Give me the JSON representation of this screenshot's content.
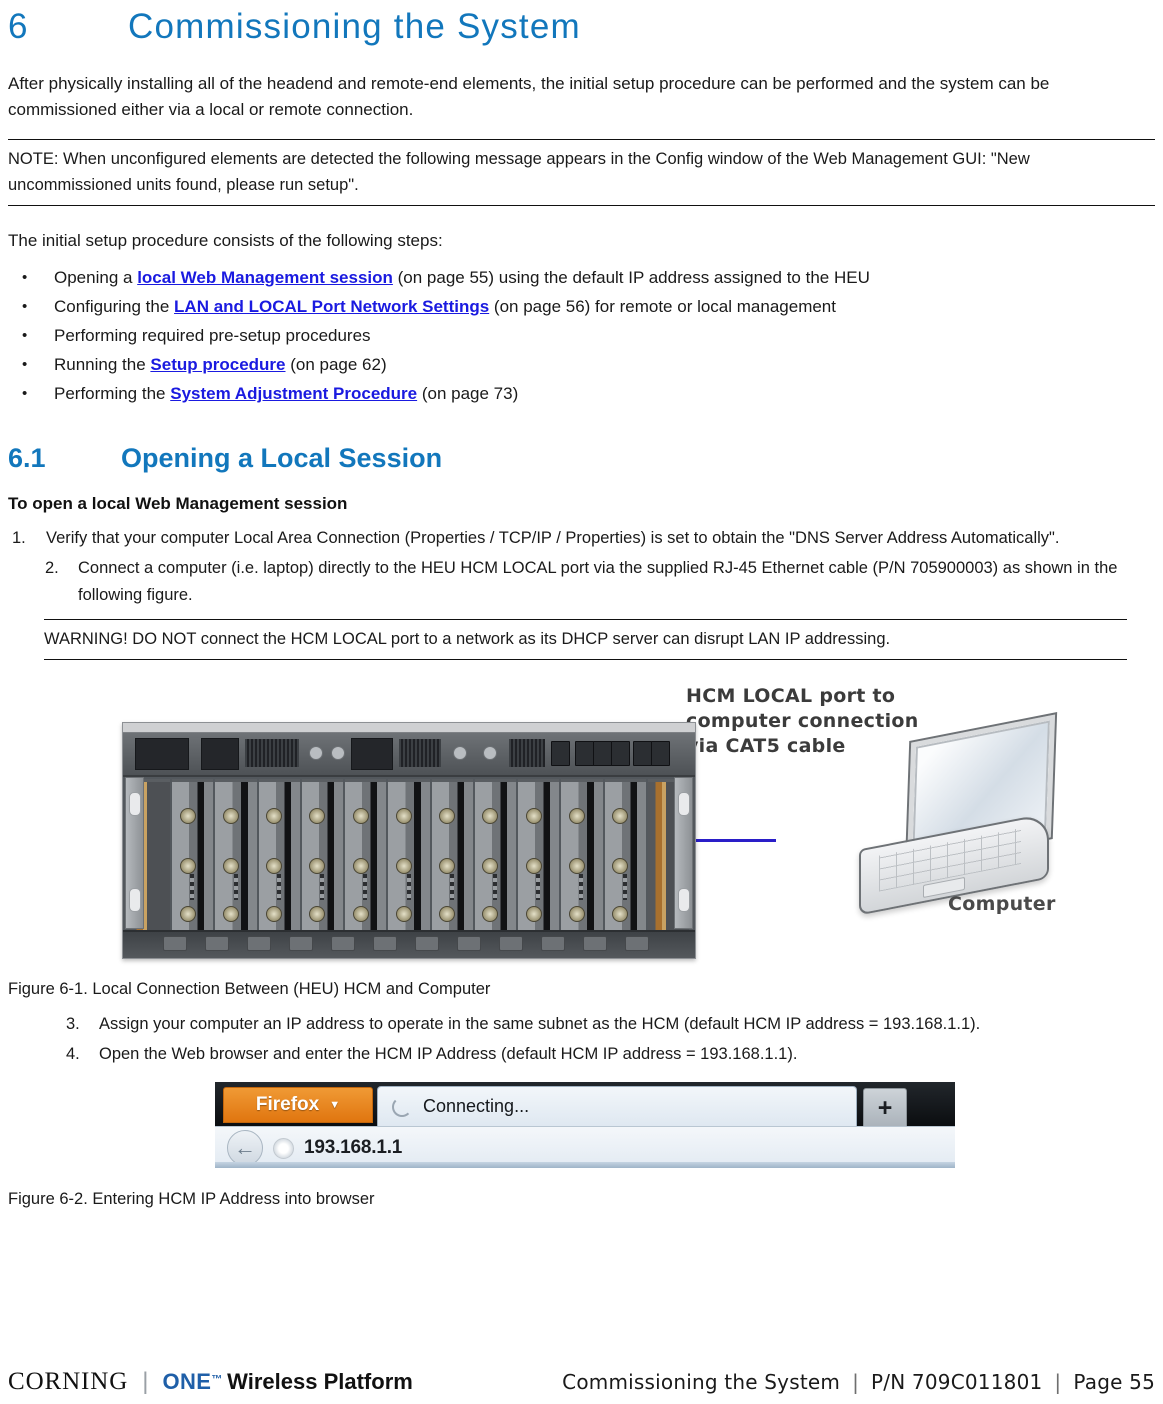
{
  "chapter": {
    "number": "6",
    "title": "Commissioning the System"
  },
  "intro_paragraph": "After physically installing all of the headend and remote-end elements, the initial setup procedure can be performed and the system can be commissioned either via a local or remote connection.",
  "note_block": "NOTE: When unconfigured elements are detected the following message appears in the Config window of the Web Management GUI: \"New uncommissioned units found, please run setup\".",
  "steps_intro": "The initial setup procedure consists of the following steps:",
  "bullets": [
    {
      "bullet": "•",
      "pre": "Opening a ",
      "link": "local Web Management session",
      "post": " (on page 55) using the default IP address assigned to the HEU"
    },
    {
      "bullet": "•",
      "pre": "Configuring the ",
      "link": "LAN and LOCAL Port Network Settings",
      "post": " (on page 56) for remote or local management"
    },
    {
      "bullet": "•",
      "pre": "Performing required pre-setup procedures",
      "link": "",
      "post": ""
    },
    {
      "bullet": "•",
      "pre": "Running the ",
      "link": "Setup procedure",
      "post": " (on page 62)"
    },
    {
      "bullet": "•",
      "pre": "Performing the ",
      "link": "System Adjustment Procedure",
      "post": " (on page 73)"
    }
  ],
  "section": {
    "number": "6.1",
    "title": "Opening a Local Session",
    "subheading": "To open a local Web Management session"
  },
  "steps": {
    "step1_num": "1.",
    "step1_text": "Verify that your computer Local Area Connection (Properties / TCP/IP / Properties) is set to obtain the \"DNS Server Address Automatically\".",
    "step2_num": "2.",
    "step2_text": "Connect a computer (i.e. laptop) directly to the HEU HCM LOCAL port via the supplied RJ-45 Ethernet cable (P/N 705900003) as shown in the following figure.",
    "step3_num": "3.",
    "step3_text": "Assign your computer an IP address to operate in the same subnet as the HCM (default HCM IP address = 193.168.1.1).",
    "step4_num": "4.",
    "step4_text": "Open the Web browser and enter the HCM IP Address (default HCM IP address = 193.168.1.1)."
  },
  "warning_block": "WARNING! DO NOT connect the HCM LOCAL port to a network as its DHCP server can disrupt LAN IP addressing.",
  "figure1": {
    "annotation_line1": "HCM LOCAL port to",
    "annotation_line2": "computer connection",
    "annotation_line3": "via CAT5 cable",
    "computer_label": "Computer",
    "caption": "Figure 6-1. Local Connection Between (HEU) HCM and Computer"
  },
  "figure2": {
    "firefox_button": "Firefox",
    "firefox_caret": "▼",
    "tab_title": "Connecting...",
    "new_tab": "+",
    "back_arrow": "←",
    "url": "193.168.1.1",
    "caption": "Figure 6-2. Entering HCM IP Address into browser"
  },
  "footer": {
    "brand_corning": "CORNING",
    "brand_separator": "|",
    "brand_one": "ONE",
    "brand_tm": "™",
    "brand_platform": "Wireless Platform",
    "doc_section": "Commissioning the System",
    "sep1": "|",
    "part_number": "P/N 709C011801",
    "sep2": "|",
    "page": "Page 55"
  },
  "colors": {
    "heading_blue": "#1277bc",
    "link_blue": "#1a1ae0",
    "brand_blue": "#1f5fa8",
    "firefox_orange": "#e0750f",
    "cable_blue": "#2a1ec8"
  }
}
